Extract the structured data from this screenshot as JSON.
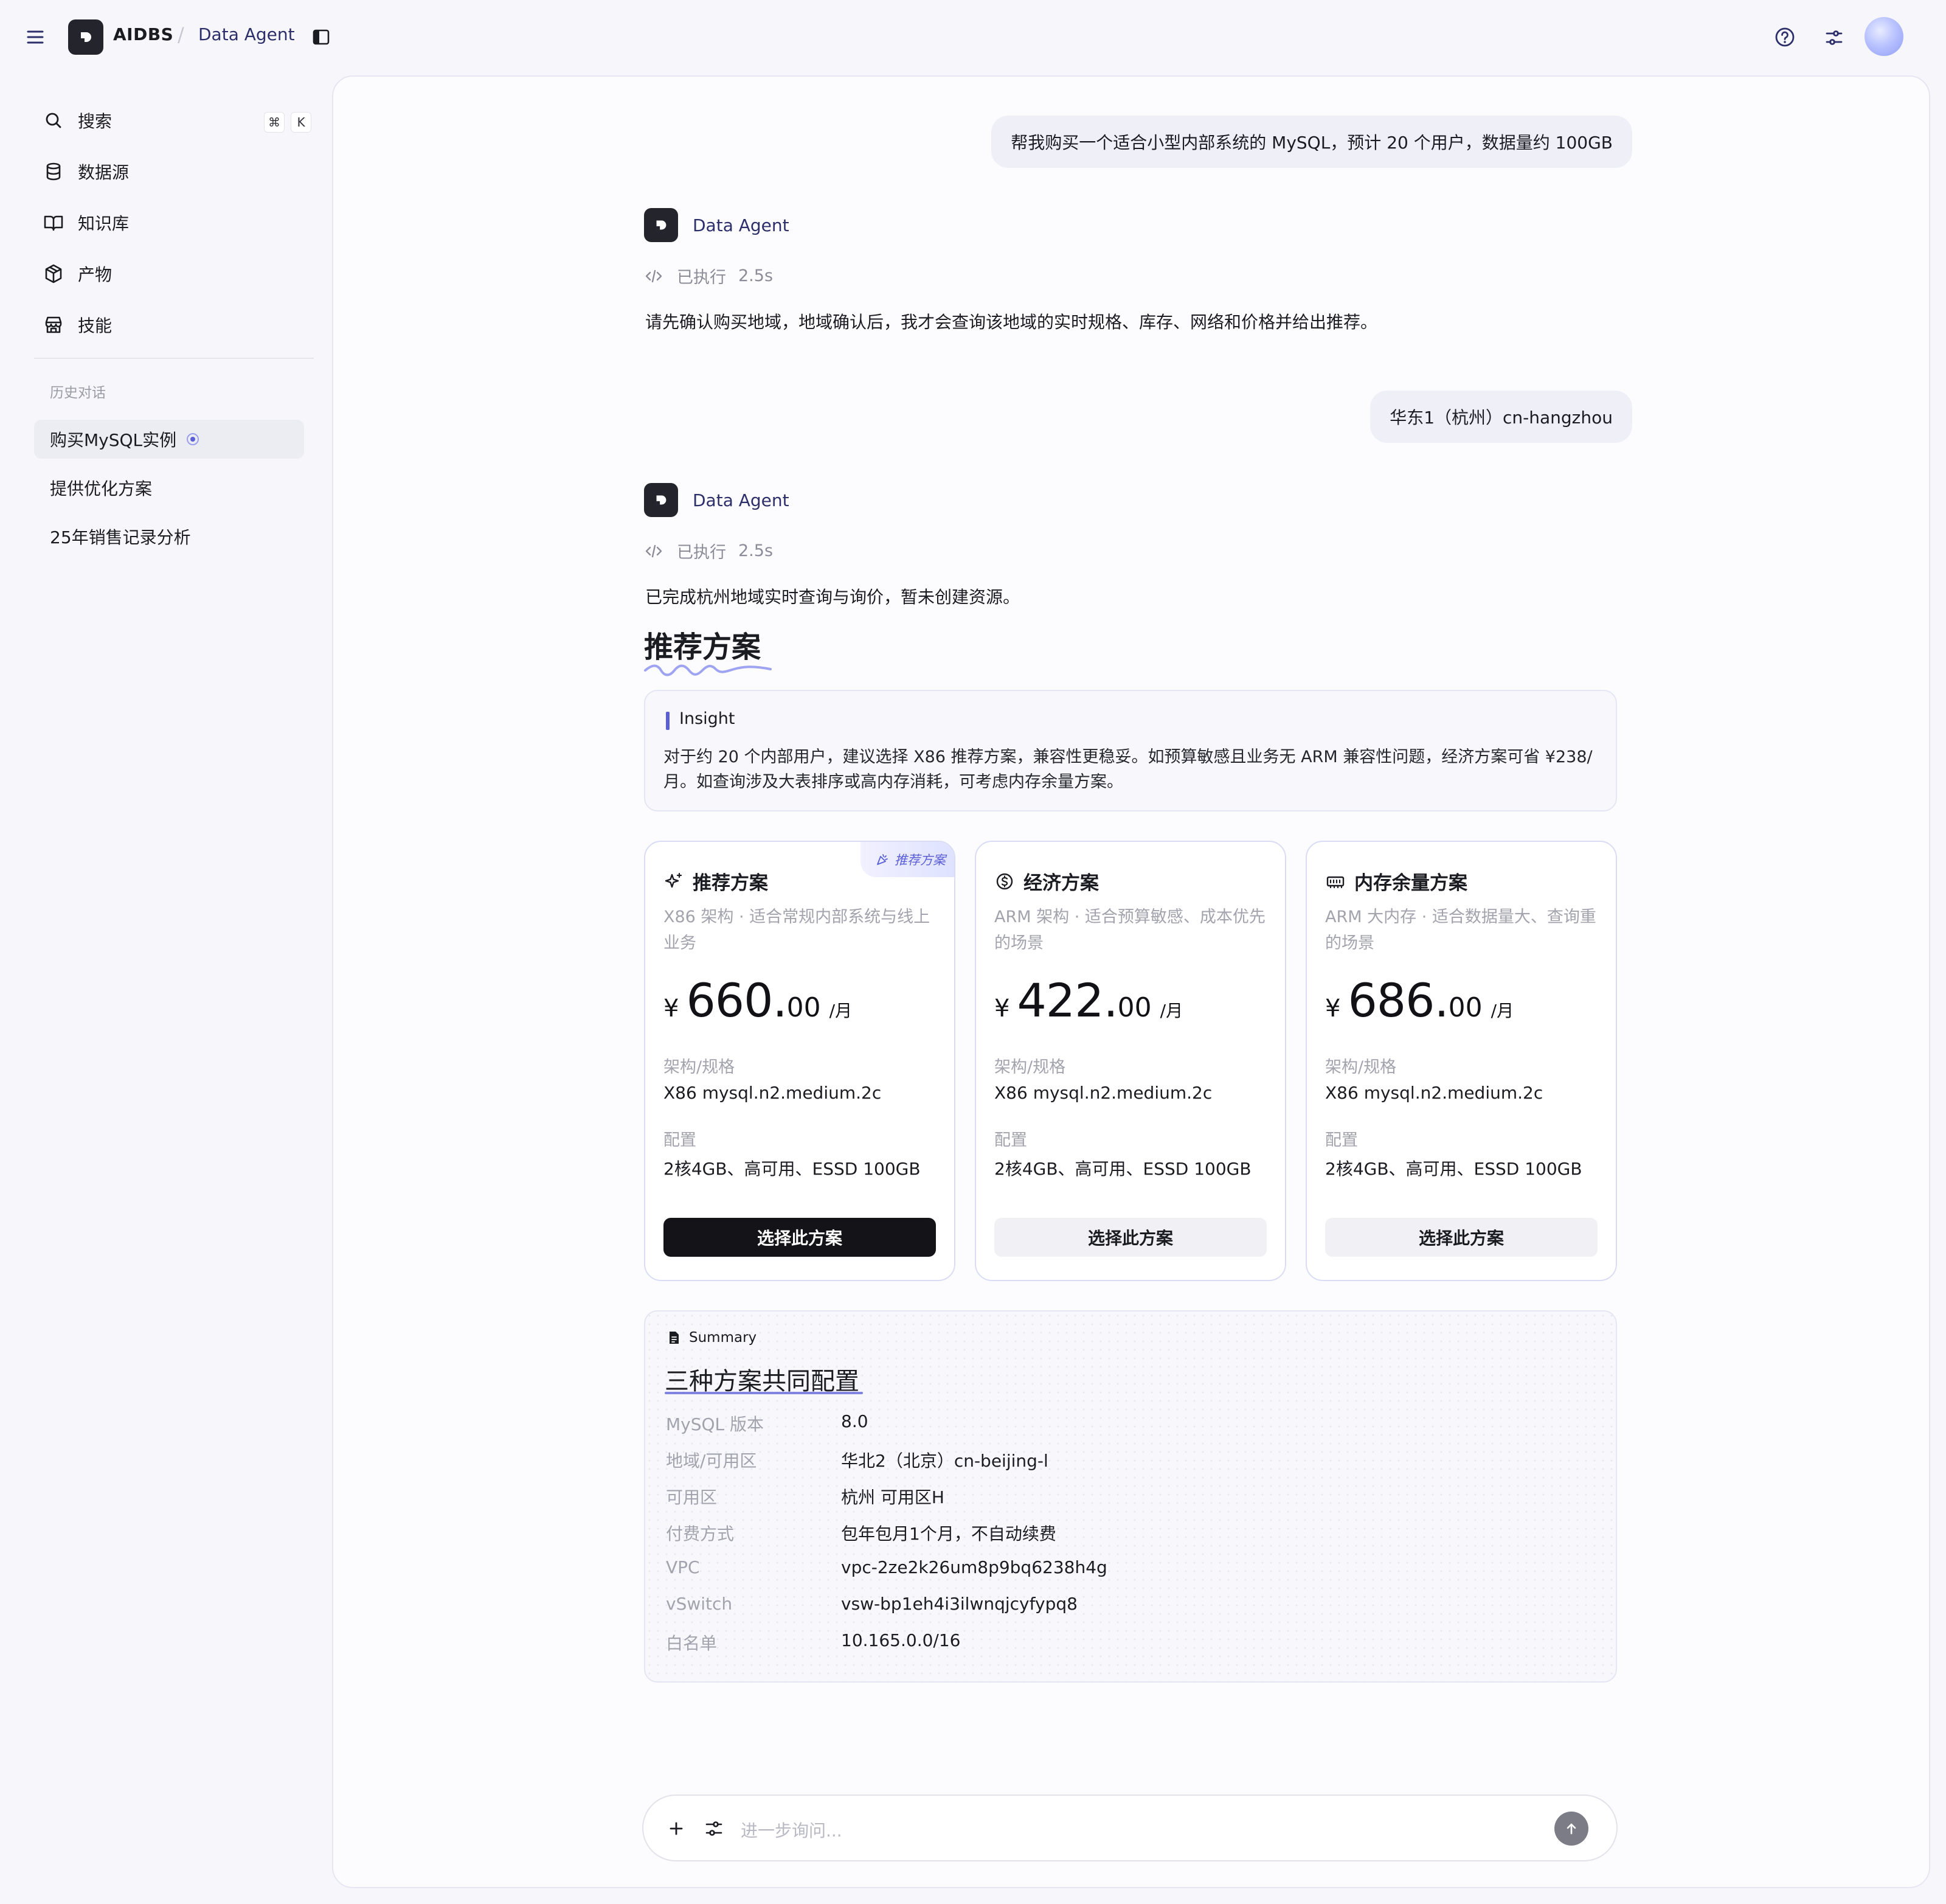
{
  "topbar": {
    "brand": "AIDBS",
    "separator": "/",
    "breadcrumb": "Data Agent"
  },
  "sidebar": {
    "items": [
      {
        "label": "搜索",
        "icon": "search-icon"
      },
      {
        "label": "数据源",
        "icon": "database-icon"
      },
      {
        "label": "知识库",
        "icon": "book-icon"
      },
      {
        "label": "产物",
        "icon": "box-icon"
      },
      {
        "label": "技能",
        "icon": "store-icon"
      }
    ],
    "shortcut": [
      "⌘",
      "K"
    ],
    "history_title": "历史对话",
    "history": [
      "购买MySQL实例",
      "提供优化方案",
      "25年销售记录分析"
    ]
  },
  "chat": {
    "user_msg_1": "帮我购买一个适合小型内部系统的 MySQL，预计 20 个用户，数据量约 100GB",
    "agent_name": "Data Agent",
    "exec_label": "已执行",
    "exec_time": "2.5s",
    "agent_msg_1": "请先确认购买地域，地域确认后，我才会查询该地域的实时规格、库存、网络和价格并给出推荐。",
    "user_msg_2": "华东1（杭州）cn-hangzhou",
    "agent_msg_2": "已完成杭州地域实时查询与询价，暂未创建资源。",
    "section_heading": "推荐方案"
  },
  "insight": {
    "title": "Insight",
    "body": "对于约 20 个内部用户，建议选择 X86 推荐方案，兼容性更稳妥。如预算敏感且业务无 ARM 兼容性问题，经济方案可省 ¥238/月。如查询涉及大表排序或高内存消耗，可考虑内存余量方案。"
  },
  "plans": [
    {
      "title": "推荐方案",
      "icon": "sparkle-icon",
      "badge": "推荐方案",
      "desc": "X86 架构 · 适合常规内部系统与线上业务",
      "currency": "¥",
      "price_int": "660.",
      "price_dec": "00",
      "unit": "/月",
      "spec_label": "架构/规格",
      "spec": "X86 mysql.n2.medium.2c",
      "config_label": "配置",
      "config": "2核4GB、高可用、ESSD 100GB",
      "button": "选择此方案",
      "primary": true
    },
    {
      "title": "经济方案",
      "icon": "dollar-icon",
      "badge": "",
      "desc": "ARM 架构 · 适合预算敏感、成本优先的场景",
      "currency": "¥",
      "price_int": "422.",
      "price_dec": "00",
      "unit": "/月",
      "spec_label": "架构/规格",
      "spec": "X86 mysql.n2.medium.2c",
      "config_label": "配置",
      "config": "2核4GB、高可用、ESSD 100GB",
      "button": "选择此方案",
      "primary": false
    },
    {
      "title": "内存余量方案",
      "icon": "memory-icon",
      "badge": "",
      "desc": "ARM 大内存 · 适合数据量大、查询重的场景",
      "currency": "¥",
      "price_int": "686.",
      "price_dec": "00",
      "unit": "/月",
      "spec_label": "架构/规格",
      "spec": "X86 mysql.n2.medium.2c",
      "config_label": "配置",
      "config": "2核4GB、高可用、ESSD 100GB",
      "button": "选择此方案",
      "primary": false
    }
  ],
  "summary": {
    "tag": "Summary",
    "heading": "三种方案共同配置",
    "rows": [
      {
        "k": "MySQL 版本",
        "v": "8.0"
      },
      {
        "k": "地域/可用区",
        "v": "华北2（北京）cn-beijing-l"
      },
      {
        "k": "可用区",
        "v": "杭州 可用区H"
      },
      {
        "k": "付费方式",
        "v": "包年包月1个月，不自动续费"
      },
      {
        "k": "VPC",
        "v": "vpc-2ze2k26um8p9bq6238h4g"
      },
      {
        "k": "vSwitch",
        "v": "vsw-bp1eh4i3ilwnqjcyfypq8"
      },
      {
        "k": "白名单",
        "v": "10.165.0.0/16"
      }
    ]
  },
  "composer": {
    "placeholder": "进一步询问..."
  },
  "colors": {
    "accent": "#5b5fd6",
    "primary_button": "#141418",
    "card_border": "#dadcf6"
  }
}
